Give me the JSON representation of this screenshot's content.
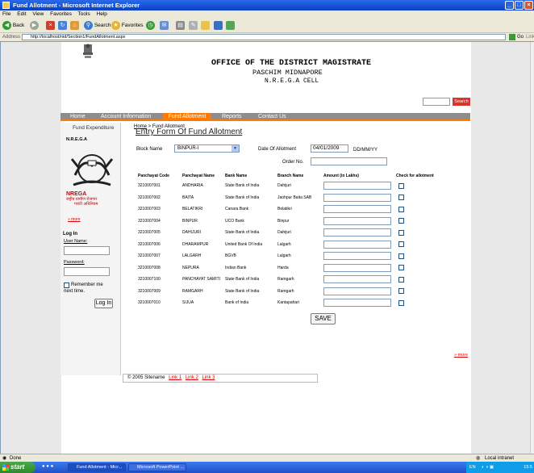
{
  "window": {
    "title": "Fund Allotment - Microsoft Internet Explorer"
  },
  "menubar": [
    "File",
    "Edit",
    "View",
    "Favorites",
    "Tools",
    "Help"
  ],
  "toolbar": {
    "back": "Back",
    "search": "Search",
    "favorites": "Favorites"
  },
  "address": {
    "label": "Address",
    "url": "http://localhost/nid/Section1/FundAllotment.aspx",
    "go": "Go",
    "links": "Links"
  },
  "header": {
    "line1": "OFFICE OF THE DISTRICT MAGISTRATE",
    "line2": "PASCHIM MIDNAPORE",
    "line3": "N.R.E.G.A CELL",
    "search_btn": "Search"
  },
  "nav": {
    "home": "Home",
    "account": "Account Information",
    "fund": "Fund Allotment",
    "reports": "Reports",
    "contact": "Contact Us"
  },
  "breadcrumb": {
    "home": "Home",
    "current": " > Fund Allotment"
  },
  "sidebar": {
    "heading": "Fund Expenditure",
    "nrega": "N.R.E.G.A",
    "nrega_logo": "NREGA",
    "nrega_hindi1": "राष्ट्रीय ग्रामीण रोजगार",
    "nrega_hindi2": "गारंटी अधिनियम",
    "more": "» more",
    "login_title": "Log In",
    "username_label": "User Name:",
    "password_label": "Password:",
    "remember1": "Remember me",
    "remember2": "next time.",
    "login_btn": "Log In"
  },
  "form": {
    "title": "Entry Form Of Fund Allotment",
    "block_label": "Block Name",
    "block_value": "BINPUR-I",
    "date_label": "Date Of Allotment",
    "date_value": "04/01/2009",
    "date_format": "DD/MM/YY",
    "order_label": "Order No.",
    "save": "SAVE",
    "more": "» more"
  },
  "table": {
    "headers": [
      "Panchayat Code",
      "Panchayat Name",
      "Bank Name",
      "Branch Name",
      "Amount (in Lakhs)",
      "Check for allotment"
    ],
    "rows": [
      [
        "3210007001",
        "ANDHARIA",
        "State Bank of India",
        "Dahijuri"
      ],
      [
        "3210007002",
        "BAITA",
        "State Bank of India",
        "Jaohpur Baita SAB"
      ],
      [
        "3210007003",
        "BELATIKRI",
        "Canara Bank",
        "Belatikri"
      ],
      [
        "3210007004",
        "BINPUR",
        "UCO Bank",
        "Binpur"
      ],
      [
        "3210007005",
        "DAHIJURI",
        "State Bank of India",
        "Dahijuri"
      ],
      [
        "3210007006",
        "DHARAMPUR",
        "United Bank Of India",
        "Lalgarh"
      ],
      [
        "3210007007",
        "LALGARH",
        "BGVB",
        "Lalgarh"
      ],
      [
        "3210007008",
        "NEPURA",
        "Indian Bank",
        "Harda"
      ],
      [
        "3210007100",
        "PANCHAYAT SAMITI",
        "State Bank of India",
        "Ramgarh"
      ],
      [
        "3210007009",
        "RAMGARH",
        "State Bank of India",
        "Ramgarh"
      ],
      [
        "3210007010",
        "SIJUA",
        "Bank of India",
        "Kantapahari"
      ]
    ]
  },
  "footer": {
    "text": "© 2005 Sitename",
    "link1": "Link 1",
    "link2": "Link 2",
    "link3": "Link 3"
  },
  "status": {
    "left": "Done",
    "right": "Local intranet"
  },
  "taskbar": {
    "start": "start",
    "task1": "Fund Allotment - Micr...",
    "task2": "Microsoft PowerPoint ...",
    "lang": "EN",
    "clock": "15:5"
  }
}
